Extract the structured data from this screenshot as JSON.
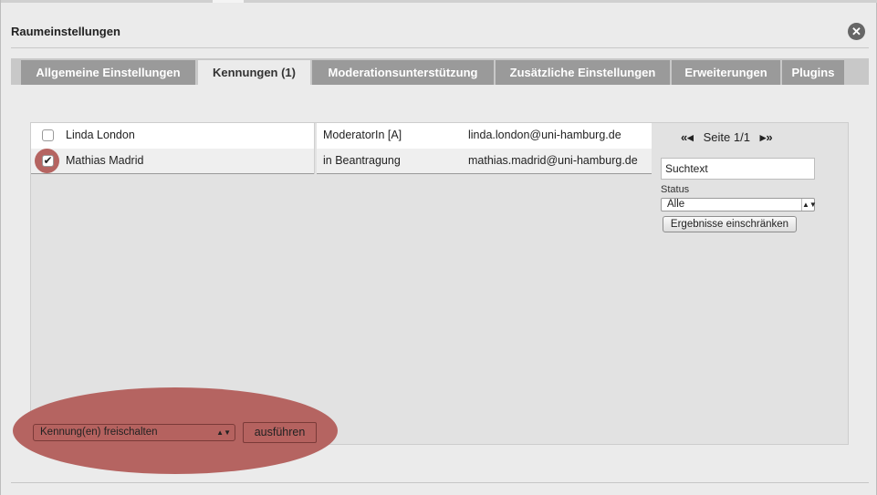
{
  "dialog": {
    "title": "Raumeinstellungen",
    "close_label": "✕"
  },
  "tabs": [
    {
      "label": "Allgemeine Einstellungen",
      "active": false
    },
    {
      "label": "Kennungen (1)",
      "active": true
    },
    {
      "label": "Moderationsunterstützung",
      "active": false
    },
    {
      "label": "Zusätzliche Einstellungen",
      "active": false
    },
    {
      "label": "Erweiterungen",
      "active": false
    },
    {
      "label": "Plugins",
      "active": false
    }
  ],
  "list": {
    "rows": [
      {
        "name": "Linda London",
        "role": "ModeratorIn [A]",
        "email": "linda.london@uni-hamburg.de",
        "checked": false
      },
      {
        "name": "Mathias Madrid",
        "role": "in Beantragung",
        "email": "mathias.madrid@uni-hamburg.de",
        "checked": true
      }
    ]
  },
  "pager": {
    "first_icon": "«",
    "prev_icon": "◂",
    "label": "Seite 1/1",
    "next_icon": "▸",
    "last_icon": "»"
  },
  "filter": {
    "search_value": "Suchtext",
    "status_label": "Status",
    "status_selected": "Alle",
    "apply_label": "Ergebnisse einschränken"
  },
  "actions": {
    "selected_action": "Kennung(en) freischalten",
    "run_label": "ausführen"
  },
  "colors": {
    "highlight": "#b56461",
    "tab_inactive": "#9a9a9a",
    "tab_active": "#ebebeb"
  }
}
